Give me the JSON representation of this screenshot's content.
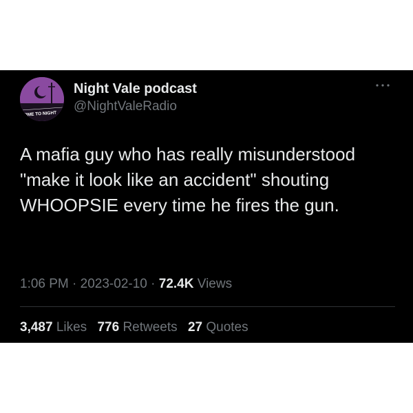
{
  "author": {
    "display_name": "Night Vale podcast",
    "handle": "@NightValeRadio",
    "avatar_text": "TIME TO NIGHT"
  },
  "tweet": {
    "text": "A mafia guy who has really misunderstood \"make it look like an accident\" shouting WHOOPSIE every time he fires the gun.",
    "time": "1:06 PM",
    "date": "2023-02-10",
    "separator": "·",
    "views_count": "72.4K",
    "views_label": "Views"
  },
  "stats": {
    "likes_count": "3,487",
    "likes_label": "Likes",
    "retweets_count": "776",
    "retweets_label": "Retweets",
    "quotes_count": "27",
    "quotes_label": "Quotes"
  },
  "icons": {
    "more": "more-horizontal-icon"
  },
  "colors": {
    "background": "#000000",
    "text_primary": "#e7e9ea",
    "text_secondary": "#71767b",
    "avatar_purple": "#8a4aa0"
  }
}
